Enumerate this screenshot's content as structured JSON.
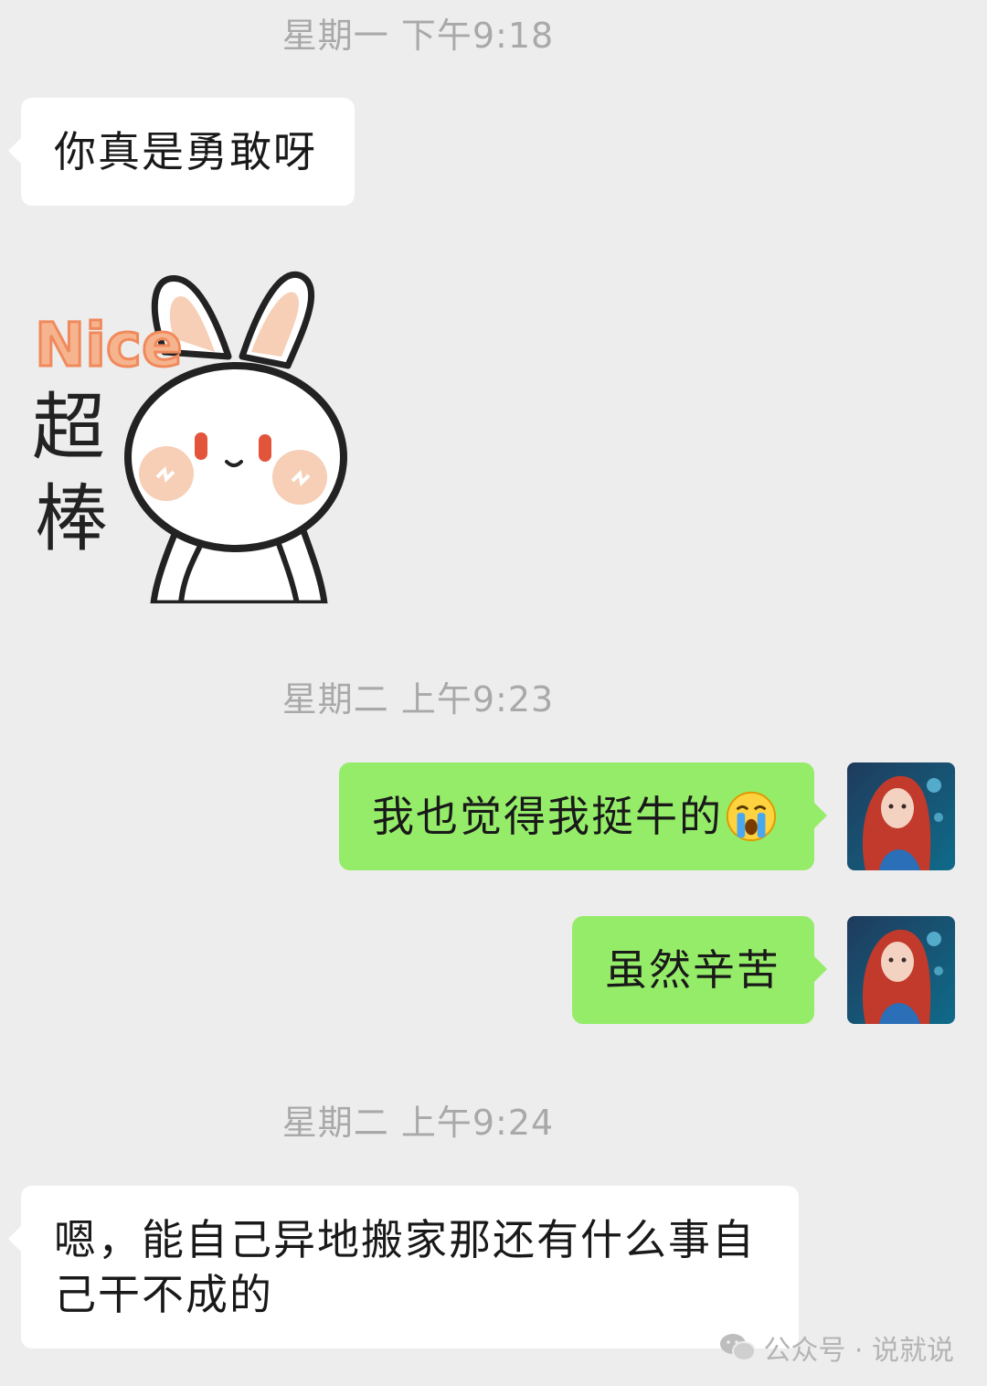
{
  "messages": {
    "ts1": "星期一 下午9:18",
    "m1": "你真是勇敢呀",
    "sticker": {
      "nice": "Nice",
      "line1": "超",
      "line2": "棒"
    },
    "ts2": "星期二 上午9:23",
    "m2": "我也觉得我挺牛的",
    "m3": "虽然辛苦",
    "ts3": "星期二 上午9:24",
    "m4_line1": "嗯，能自己异地搬家那还有什么事自",
    "m4_line2": "己干不成的"
  },
  "watermark": {
    "text": "公众号 · 说就说",
    "icon": "wechat-icon"
  },
  "colors": {
    "background": "#ededed",
    "incoming_bubble": "#ffffff",
    "outgoing_bubble": "#95ec69",
    "timestamp_text": "#a9a9a9"
  }
}
